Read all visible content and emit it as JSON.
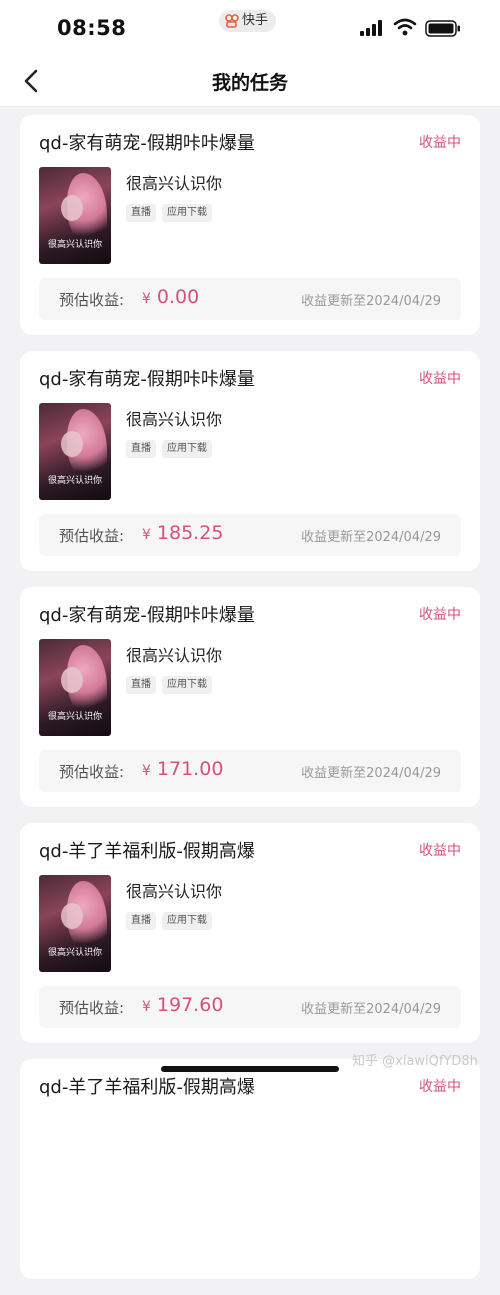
{
  "status_bar": {
    "time": "08:58",
    "app_badge": "快手",
    "icons": [
      "signal-icon",
      "wifi-icon",
      "battery-icon"
    ]
  },
  "nav": {
    "back_icon": "chevron-left-icon",
    "title": "我的任务"
  },
  "colors": {
    "accent": "#d4527a",
    "card_bg": "#ffffff",
    "page_bg": "#f2f2f4"
  },
  "tasks": [
    {
      "title": "qd-家有萌宠-假期咔咔爆量",
      "status": "收益中",
      "subtitle": "很高兴认识你",
      "thumb_caption": "很高兴认识你",
      "tags": [
        "直播",
        "应用下载"
      ],
      "earn_label": "预估收益:",
      "currency": "¥",
      "amount": "0.00",
      "update_text": "收益更新至2024/04/29"
    },
    {
      "title": "qd-家有萌宠-假期咔咔爆量",
      "status": "收益中",
      "subtitle": "很高兴认识你",
      "thumb_caption": "很高兴认识你",
      "tags": [
        "直播",
        "应用下载"
      ],
      "earn_label": "预估收益:",
      "currency": "¥",
      "amount": "185.25",
      "update_text": "收益更新至2024/04/29"
    },
    {
      "title": "qd-家有萌宠-假期咔咔爆量",
      "status": "收益中",
      "subtitle": "很高兴认识你",
      "thumb_caption": "很高兴认识你",
      "tags": [
        "直播",
        "应用下载"
      ],
      "earn_label": "预估收益:",
      "currency": "¥",
      "amount": "171.00",
      "update_text": "收益更新至2024/04/29"
    },
    {
      "title": "qd-羊了羊福利版-假期高爆",
      "status": "收益中",
      "subtitle": "很高兴认识你",
      "thumb_caption": "很高兴认识你",
      "tags": [
        "直播",
        "应用下载"
      ],
      "earn_label": "预估收益:",
      "currency": "¥",
      "amount": "197.60",
      "update_text": "收益更新至2024/04/29"
    },
    {
      "title": "qd-羊了羊福利版-假期高爆",
      "status": "收益中"
    }
  ],
  "watermark": "知乎 @xiawiQfYD8h"
}
